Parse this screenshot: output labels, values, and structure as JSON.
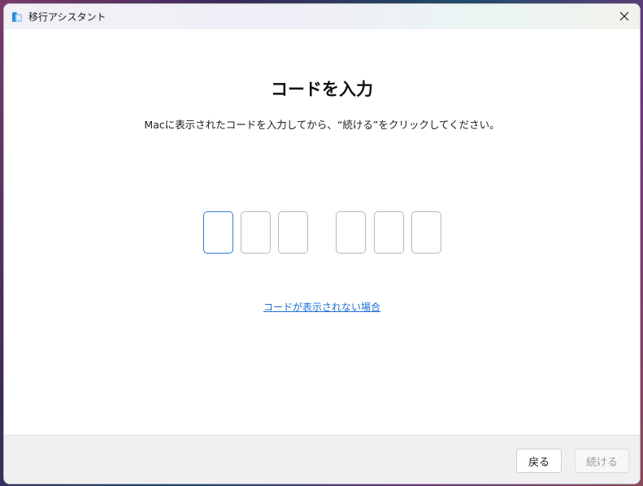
{
  "window": {
    "title": "移行アシスタント",
    "app_icon": "migration-assistant-icon",
    "close_icon": "close-icon"
  },
  "main": {
    "heading": "コードを入力",
    "instruction": "Macに表示されたコードを入力してから、“続ける”をクリックしてください。",
    "code_digits": [
      "",
      "",
      "",
      "",
      "",
      ""
    ],
    "help_link": "コードが表示されない場合"
  },
  "footer": {
    "back_label": "戻る",
    "continue_label": "続ける"
  },
  "colors": {
    "accent": "#2a7bd4",
    "link": "#1a6fd8",
    "footer_bg": "#f0eff2"
  }
}
